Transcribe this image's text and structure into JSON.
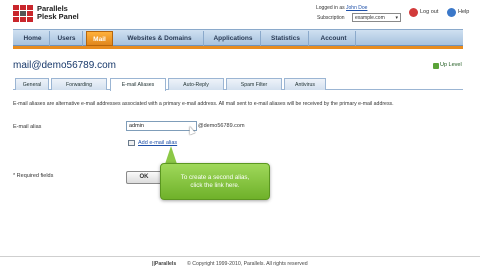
{
  "header": {
    "brand_line1": "Parallels",
    "brand_line2": "Plesk Panel",
    "logged_in_label": "Logged in as",
    "user_name": "John Doe",
    "subscription_label": "Subscription",
    "subscription_value": "example.com",
    "logout_label": "Log out",
    "help_label": "Help"
  },
  "nav": {
    "tabs": [
      {
        "label": "Home"
      },
      {
        "label": "Users"
      },
      {
        "label": "Mail"
      },
      {
        "label": "Websites & Domains"
      },
      {
        "label": "Applications"
      },
      {
        "label": "Statistics"
      },
      {
        "label": "Account"
      }
    ],
    "active_tab": "Mail"
  },
  "page": {
    "title": "mail@demo56789.com",
    "up_level": "Up Level"
  },
  "subtabs": [
    {
      "label": "General"
    },
    {
      "label": "Forwarding"
    },
    {
      "label": "E-mail Aliases"
    },
    {
      "label": "Auto-Reply"
    },
    {
      "label": "Spam Filter"
    },
    {
      "label": "Antivirus"
    }
  ],
  "active_subtab": "E-mail Aliases",
  "form": {
    "description": "E-mail aliases are alternative e-mail addresses associated with a primary e-mail address. All mail sent to e-mail aliases will be received by the primary e-mail address.",
    "alias_label": "E-mail alias",
    "alias_value": "admin",
    "domain_suffix": "@demo56789.com",
    "add_link": "Add e-mail alias",
    "required_note": "* Required fields",
    "ok_label": "OK"
  },
  "callout": {
    "line1": "To create a second alias,",
    "line2": "click the link here."
  },
  "footer": {
    "brand": "||Parallels",
    "copyright": "© Copyright 1999-2010, Parallels. All rights reserved"
  },
  "colors": {
    "accent_orange": "#e88c1f",
    "nav_blue": "#a7c2de",
    "title_blue": "#17386a",
    "callout_green": "#7cbf35"
  },
  "icons": [
    "parallels-logo-icon",
    "logout-icon",
    "help-icon",
    "up-level-icon",
    "add-alias-icon"
  ]
}
